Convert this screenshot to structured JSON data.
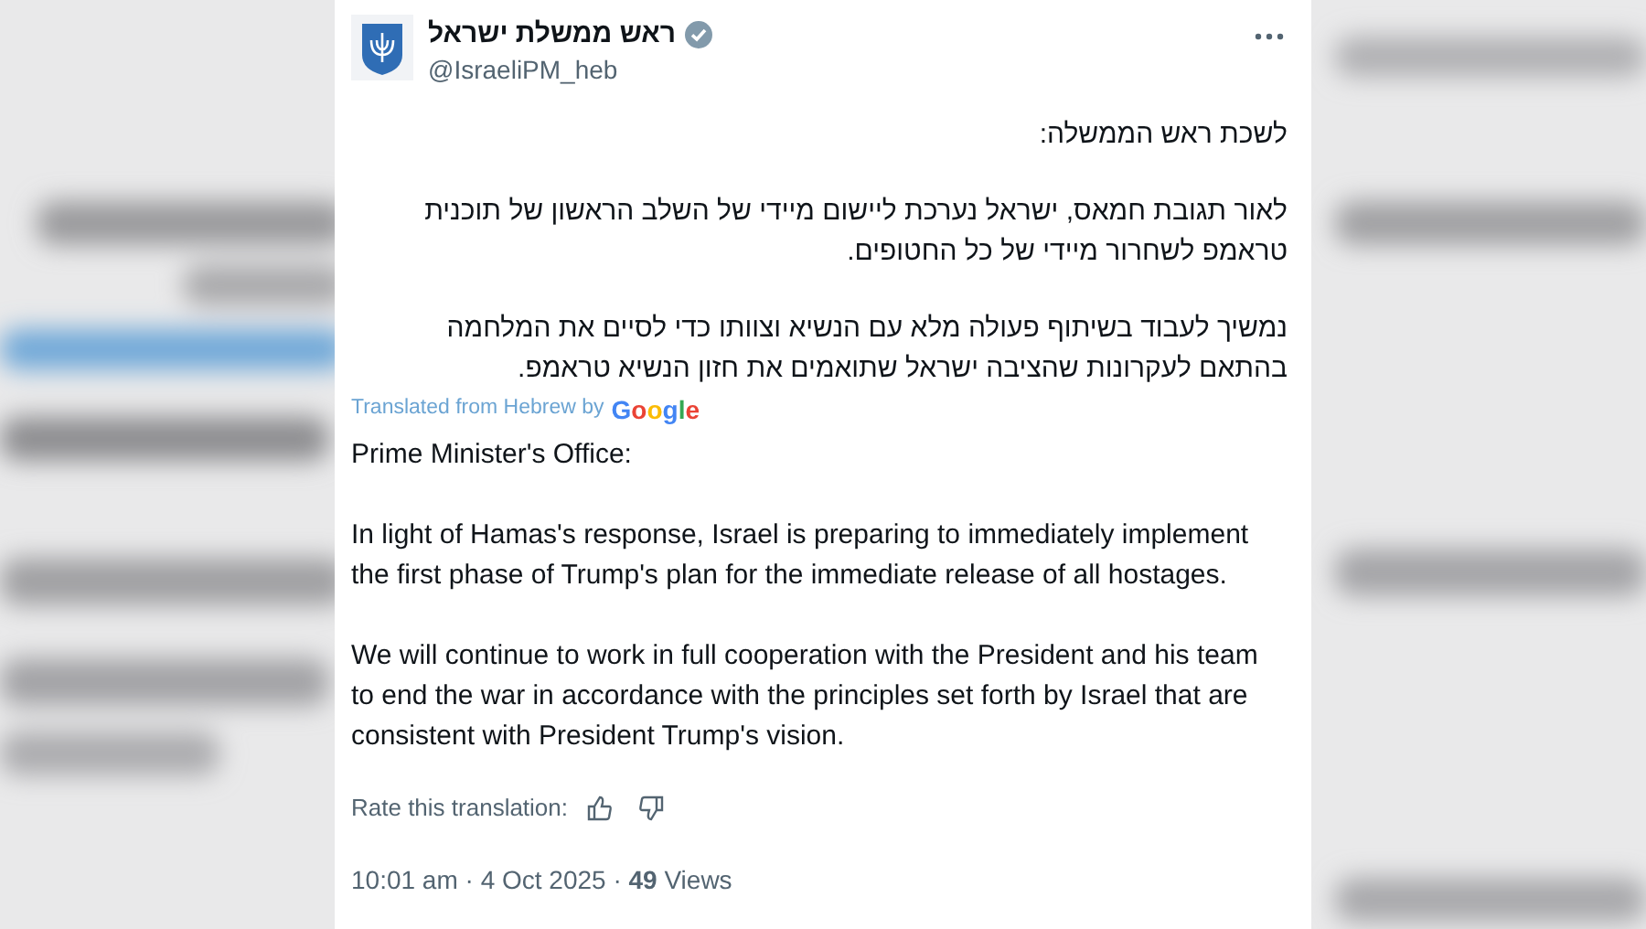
{
  "post": {
    "author": {
      "name": "ראש ממשלת ישראל",
      "handle": "@IsraeliPM_heb",
      "verified": true
    },
    "original_paragraphs": [
      "לשכת ראש הממשלה:",
      "לאור תגובת חמאס, ישראל נערכת ליישום מיידי של השלב הראשון של תוכנית טראמפ לשחרור מיידי של כל החטופים.",
      "נמשיך לעבוד בשיתוף פעולה מלא עם הנשיא וצוותו כדי לסיים את המלחמה בהתאם לעקרונות שהציבה ישראל שתואמים את חזון הנשיא טראמפ."
    ],
    "translation_note": "Translated from Hebrew by",
    "translation_brand": "Google",
    "translated_paragraphs": [
      "Prime Minister's Office:",
      "In light of Hamas's response, Israel is preparing to immediately implement the first phase of Trump's plan for the immediate release of all hostages.",
      "We will continue to work in full cooperation with the President and his team to end the war in accordance with the principles set forth by Israel that are consistent with President Trump's vision."
    ],
    "rate_label": "Rate this translation:",
    "timestamp": "10:01 am · 4 Oct 2025 · **49** Views"
  }
}
